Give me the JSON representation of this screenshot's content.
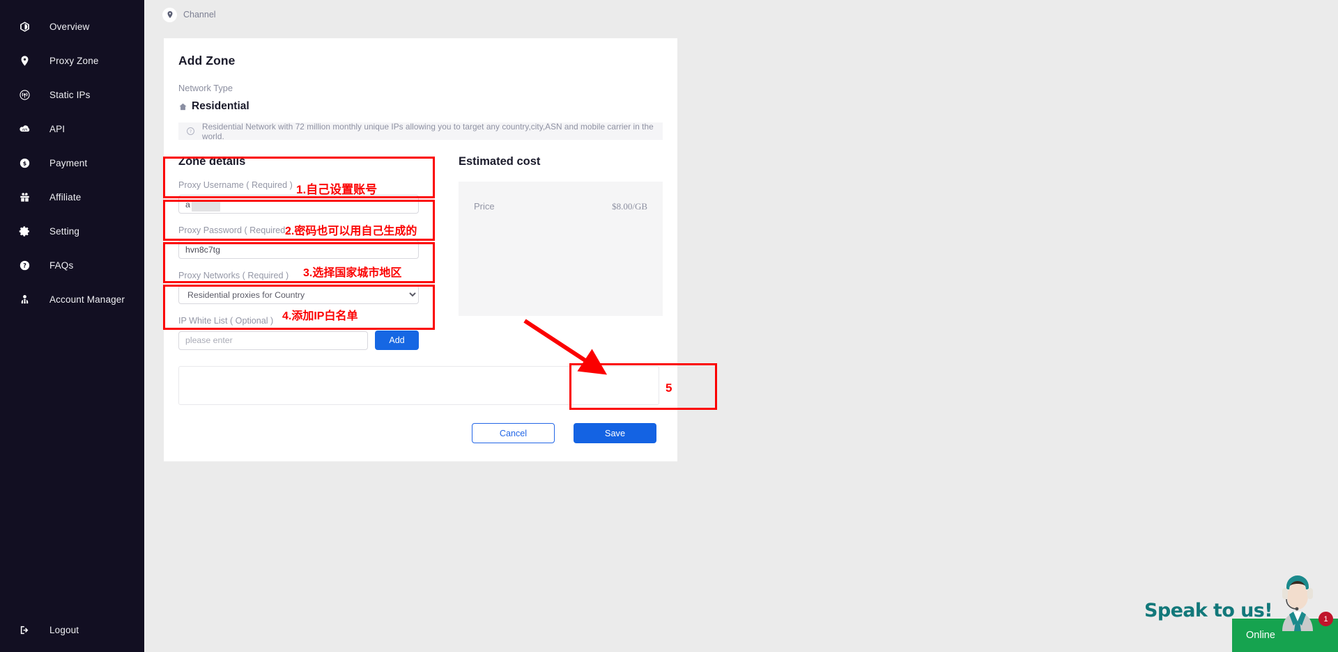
{
  "sidebar": {
    "items": [
      {
        "label": "Overview",
        "icon": "dashboard-icon"
      },
      {
        "label": "Proxy Zone",
        "icon": "location-pin-icon"
      },
      {
        "label": "Static IPs",
        "icon": "broadcast-icon"
      },
      {
        "label": "API",
        "icon": "api-cloud-icon"
      },
      {
        "label": "Payment",
        "icon": "dollar-coin-icon"
      },
      {
        "label": "Affiliate",
        "icon": "gift-icon"
      },
      {
        "label": "Setting",
        "icon": "gear-icon"
      },
      {
        "label": "FAQs",
        "icon": "question-circle-icon"
      },
      {
        "label": "Account Manager",
        "icon": "user-tie-icon"
      }
    ],
    "logout": {
      "label": "Logout",
      "icon": "logout-icon"
    }
  },
  "breadcrumb": {
    "label": "Channel",
    "icon": "location-pin-icon"
  },
  "card": {
    "title": "Add Zone",
    "network_type_label": "Network Type",
    "network_type_value": "Residential",
    "network_type_icon": "home-icon",
    "notice_icon": "question-circle-icon",
    "notice": "Residential Network with 72 million monthly unique IPs allowing you to target any country,city,ASN and mobile carrier in the world."
  },
  "zone_details": {
    "heading": "Zone details",
    "fields": [
      {
        "label": "Proxy Username ( Required )",
        "value": "a",
        "placeholder": "",
        "type": "text",
        "name": "proxy-username-input"
      },
      {
        "label": "Proxy Password ( Required )",
        "value": "hvn8c7tg",
        "placeholder": "",
        "type": "text",
        "name": "proxy-password-input"
      },
      {
        "label": "Proxy Networks ( Required )",
        "value": "Residential proxies for Country",
        "type": "select",
        "name": "proxy-networks-select",
        "options": [
          "Residential proxies for Country"
        ]
      },
      {
        "label": "IP White List ( Optional )",
        "value": "",
        "placeholder": "please enter",
        "type": "text-with-button",
        "name": "ip-white-list-input",
        "button_label": "Add"
      }
    ]
  },
  "estimated_cost": {
    "heading": "Estimated cost",
    "rows": [
      {
        "key": "Price",
        "value": "$8.00/GB"
      }
    ]
  },
  "actions": {
    "cancel_label": "Cancel",
    "save_label": "Save"
  },
  "annotations": [
    {
      "text": "1.自己设置账号",
      "num": "1"
    },
    {
      "text": "2.密码也可以用自己生成的",
      "num": "2"
    },
    {
      "text": "3.选择国家城市地区",
      "num": "3"
    },
    {
      "text": "4.添加IP白名单",
      "num": "4"
    },
    {
      "text": "5",
      "num": "5"
    }
  ],
  "chat": {
    "speak_label": "Speak to us!",
    "online_label": "Online",
    "unread_badge": "1",
    "agent_icon": "support-agent-icon"
  },
  "colors": {
    "sidebar_bg": "#120f22",
    "page_bg": "#ebebeb",
    "card_bg": "#ffffff",
    "accent_blue": "#1463e3",
    "annotation_red": "#fb0000",
    "chat_green": "#16a34f",
    "chat_teal": "#12787a",
    "badge_red": "#c0152b"
  }
}
